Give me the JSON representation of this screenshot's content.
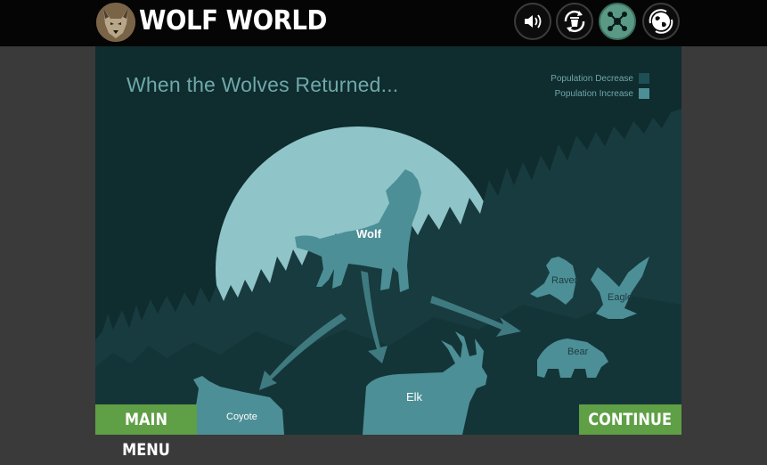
{
  "header": {
    "title": "WOLF WORLD",
    "buttons": [
      {
        "name": "sound",
        "icon": "speaker-icon"
      },
      {
        "name": "recycle",
        "icon": "trash-recycle-icon"
      },
      {
        "name": "network",
        "icon": "network-icon",
        "active": true
      },
      {
        "name": "globe",
        "icon": "globe-icon"
      }
    ]
  },
  "scene": {
    "title": "When the Wolves Returned...",
    "legend": {
      "decrease": "Population Decrease",
      "increase": "Population Increase"
    },
    "animals": {
      "wolf": "Wolf",
      "elk": "Elk",
      "coyote": "Coyote",
      "raven": "Raven",
      "eagle": "Eagle",
      "bear": "Bear"
    }
  },
  "footer": {
    "main_menu": "MAIN MENU",
    "continue": "CONTINUE"
  },
  "colors": {
    "background": "#0f2c2e",
    "moon": "#8fc4c8",
    "forest": "#173b3e",
    "decrease": "#1e4f54",
    "increase": "#4d8f96",
    "button_green": "#5f9f45"
  }
}
